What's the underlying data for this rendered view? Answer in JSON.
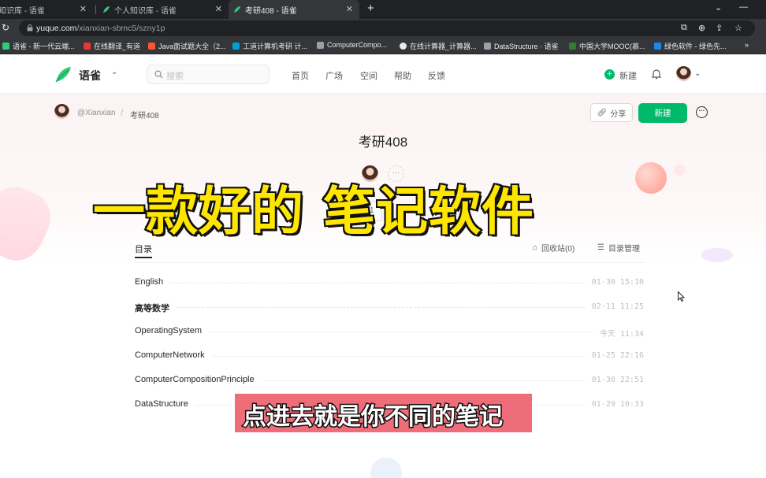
{
  "browser": {
    "tabs": [
      {
        "title": "知识库 - 语雀"
      },
      {
        "title": "个人知识库 - 语雀"
      },
      {
        "title": "考研408 - 语雀"
      }
    ],
    "url_host": "yuque.com",
    "url_path": "/xianxian-sbmc5/szny1p",
    "bookmarks": [
      {
        "label": "语雀 - 新一代云端..."
      },
      {
        "label": "在线翻译_有道"
      },
      {
        "label": "Java面试题大全（2..."
      },
      {
        "label": "工道计算机考研 计..."
      },
      {
        "label": "ComputerCompo..."
      },
      {
        "label": "在线计算器_计算器..."
      },
      {
        "label": "DataStructure · 语雀"
      },
      {
        "label": "中国大学MOOC(慕..."
      },
      {
        "label": "绿色软件 - 绿色先..."
      }
    ],
    "bookmarks_more": "»"
  },
  "nav": {
    "brand": "语雀",
    "search_placeholder": "搜索",
    "links": [
      "首页",
      "广场",
      "空间",
      "帮助",
      "反馈"
    ],
    "new_label": "新建"
  },
  "book": {
    "owner": "@Xianxian",
    "separator": "/",
    "crumb_name": "考研408",
    "title": "考研408",
    "share_label": "分享",
    "create_label": "新建",
    "follow_count": "1",
    "member_more": "···"
  },
  "toc": {
    "tab_label": "目录",
    "archive_label": "回收站(0)",
    "manage_label": "目录管理",
    "items": [
      {
        "name": "English",
        "time": "01-30 15:10"
      },
      {
        "name": "高等数学",
        "time": "02-11 11:25"
      },
      {
        "name": "OperatingSystem",
        "time": "今天 11:34"
      },
      {
        "name": "ComputerNetwork",
        "time": "01-25 22:16"
      },
      {
        "name": "ComputerCompositionPrinciple",
        "time": "01-30 22:51"
      },
      {
        "name": "DataStructure",
        "time": "01-29 10:33"
      }
    ]
  },
  "overlay": {
    "title": "一款好的 笔记软件",
    "subtitle": "点进去就是你不同的笔记"
  },
  "colors": {
    "brand_green": "#00b96b",
    "caption_yellow": "#ffe600",
    "subtitle_bg": "#ef6d79"
  }
}
